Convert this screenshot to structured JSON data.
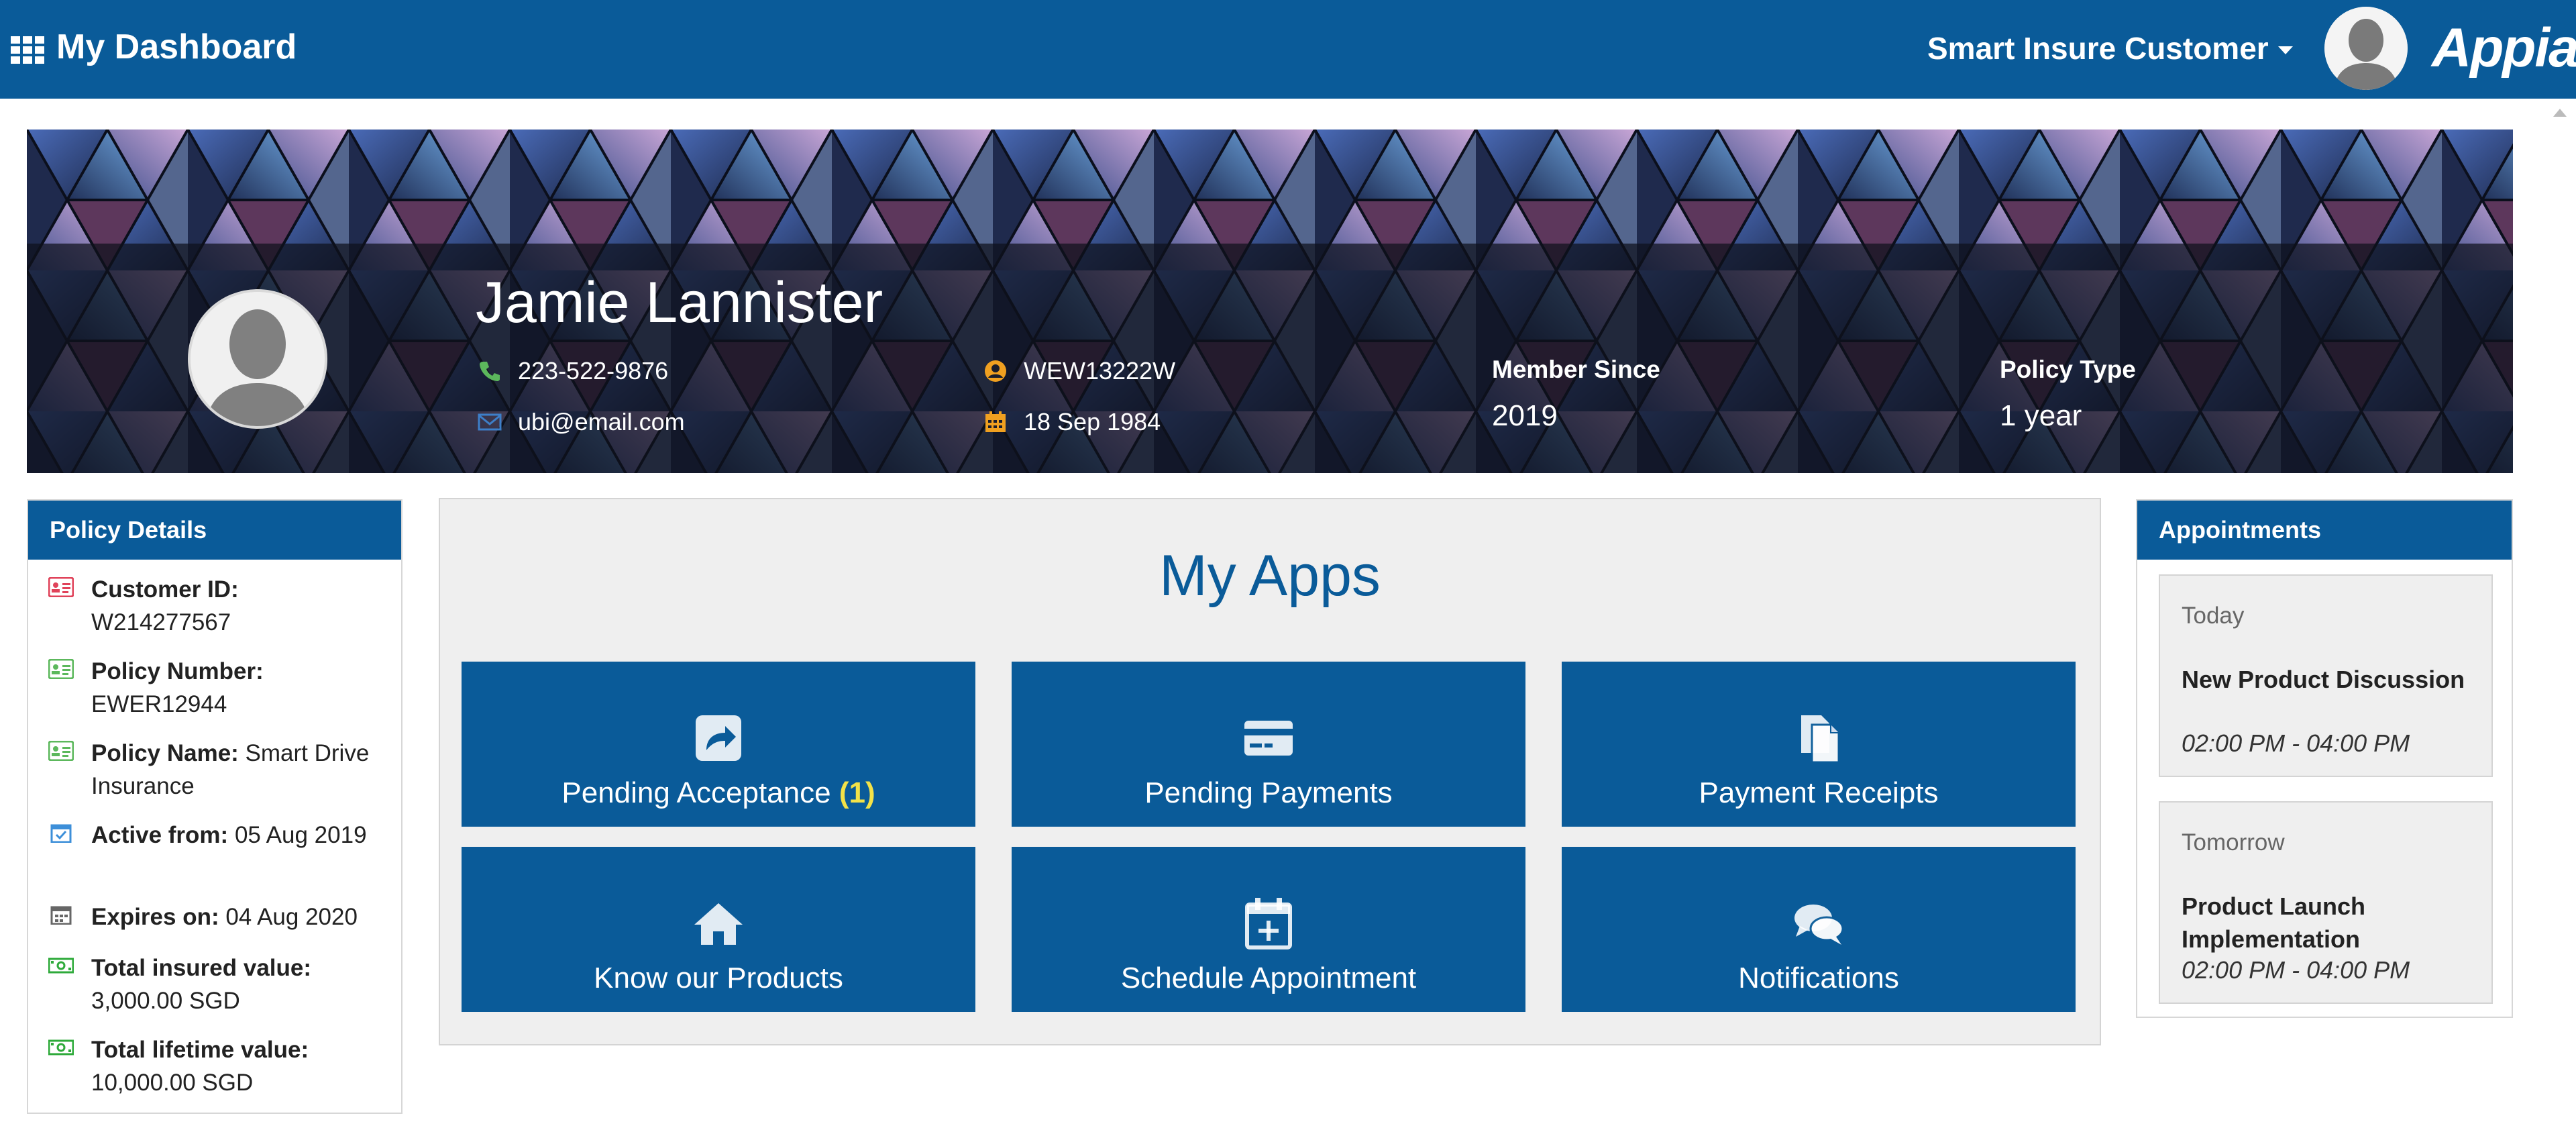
{
  "header": {
    "title": "My Dashboard",
    "user_menu": "Smart Insure Customer",
    "brand": "Appian"
  },
  "profile": {
    "name": "Jamie Lannister",
    "phone": "223-522-9876",
    "email": "ubi@email.com",
    "member_id": "WEW13222W",
    "dob": "18 Sep 1984",
    "member_since_label": "Member Since",
    "member_since": "2019",
    "policy_type_label": "Policy Type",
    "policy_type": "1 year"
  },
  "policy": {
    "header": "Policy Details",
    "customer_id_label": "Customer ID:",
    "customer_id": "W214277567",
    "policy_number_label": "Policy Number:",
    "policy_number": "EWER12944",
    "policy_name_label": "Policy Name:",
    "policy_name": "Smart Drive Insurance",
    "active_from_label": "Active from:",
    "active_from": "05 Aug 2019",
    "expires_label": "Expires on:",
    "expires": "04 Aug 2020",
    "insured_label": "Total insured value:",
    "insured": "3,000.00 SGD",
    "lifetime_label": "Total lifetime value:",
    "lifetime": "10,000.00 SGD"
  },
  "apps": {
    "title": "My Apps",
    "tiles": [
      {
        "label": "Pending Acceptance",
        "count": "(1)",
        "icon": "share-arrow-icon"
      },
      {
        "label": "Pending Payments",
        "icon": "credit-card-icon"
      },
      {
        "label": "Payment Receipts",
        "icon": "documents-icon"
      },
      {
        "label": "Know our Products",
        "icon": "home-icon"
      },
      {
        "label": "Schedule Appointment",
        "icon": "calendar-plus-icon"
      },
      {
        "label": "Notifications",
        "icon": "chat-bubbles-icon"
      }
    ]
  },
  "appointments": {
    "header": "Appointments",
    "items": [
      {
        "day": "Today",
        "title": "New Product Discussion",
        "time": "02:00 PM - 04:00 PM"
      },
      {
        "day": "Tomorrow",
        "title": "Product Launch Implementation",
        "time": "02:00 PM - 04:00 PM"
      }
    ]
  },
  "colors": {
    "brand_blue": "#0a5b99",
    "panel_gray": "#efefef",
    "count_yellow": "#f3e248",
    "phone_green": "#5cb85c",
    "id_orange": "#f0a020"
  }
}
